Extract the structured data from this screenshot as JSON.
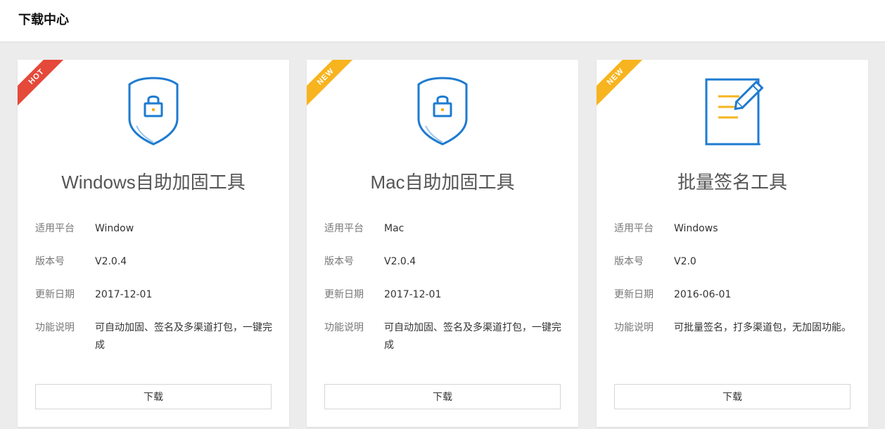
{
  "header": {
    "title": "下载中心"
  },
  "cards": [
    {
      "badge": "HOT",
      "icon": "shield-lock-icon",
      "title": "Windows自助加固工具",
      "rows": [
        {
          "label": "适用平台",
          "value": "Window"
        },
        {
          "label": "版本号",
          "value": "V2.0.4"
        },
        {
          "label": "更新日期",
          "value": "2017-12-01"
        },
        {
          "label": "功能说明",
          "value": "可自动加固、签名及多渠道打包，一键完成"
        }
      ],
      "button": "下载"
    },
    {
      "badge": "NEW",
      "icon": "shield-lock-icon",
      "title": "Mac自助加固工具",
      "rows": [
        {
          "label": "适用平台",
          "value": "Mac"
        },
        {
          "label": "版本号",
          "value": "V2.0.4"
        },
        {
          "label": "更新日期",
          "value": "2017-12-01"
        },
        {
          "label": "功能说明",
          "value": "可自动加固、签名及多渠道打包，一键完成"
        }
      ],
      "button": "下载"
    },
    {
      "badge": "NEW",
      "icon": "document-edit-icon",
      "title": "批量签名工具",
      "rows": [
        {
          "label": "适用平台",
          "value": "Windows"
        },
        {
          "label": "版本号",
          "value": "V2.0"
        },
        {
          "label": "更新日期",
          "value": "2016-06-01"
        },
        {
          "label": "功能说明",
          "value": "可批量签名，打多渠道包，无加固功能。"
        }
      ],
      "button": "下载"
    }
  ],
  "colors": {
    "hot": "#e5493a",
    "new": "#f7b41e",
    "icon_blue": "#1e7bd0",
    "icon_yellow": "#f7b41e"
  }
}
